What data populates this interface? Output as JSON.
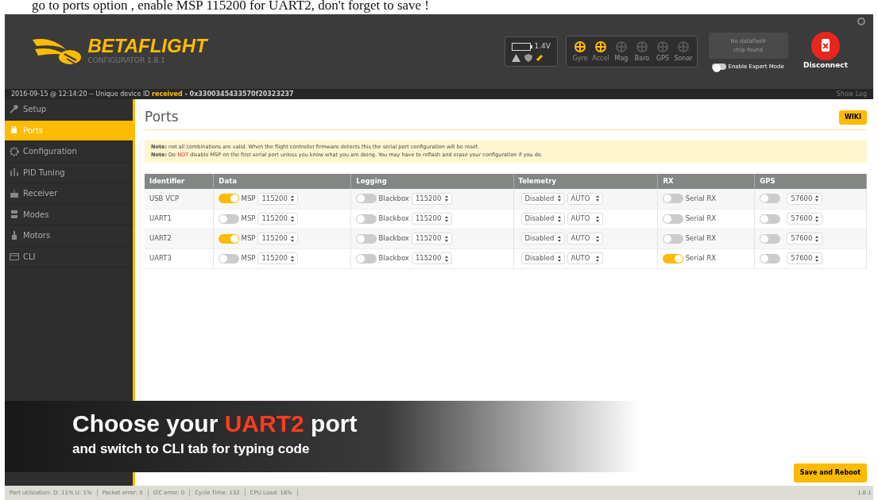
{
  "video_caption": "go to ports option , enable MSP 115200 for UART2, don't forget to save !",
  "header": {
    "logo_title": "BETAFLIGHT",
    "logo_subtitle": "CONFIGURATOR 1.8.1",
    "battery": "1.4V",
    "sensors": [
      {
        "label": "Gyro",
        "active": true
      },
      {
        "label": "Accel",
        "active": true
      },
      {
        "label": "Mag",
        "active": false
      },
      {
        "label": "Baro",
        "active": false
      },
      {
        "label": "GPS",
        "active": false
      },
      {
        "label": "Sonar",
        "active": false
      }
    ],
    "dataflash": "No dataflash chip found",
    "expert_mode": {
      "label": "Enable Expert Mode",
      "on": false
    },
    "disconnect": "Disconnect"
  },
  "log": {
    "parts": [
      {
        "text": "2016-09-15 @ 12:14:20 -- Unique device ID ",
        "kind": "plain"
      },
      {
        "text": "received",
        "kind": "highlight"
      },
      {
        "text": " - 0x3300345433570f20323237",
        "kind": "bold"
      }
    ],
    "show_log": "Show Log"
  },
  "sidebar": {
    "items": [
      {
        "label": "Setup",
        "selected": false
      },
      {
        "label": "Ports",
        "selected": true
      },
      {
        "label": "Configuration",
        "selected": false
      },
      {
        "label": "PID Tuning",
        "selected": false
      },
      {
        "label": "Receiver",
        "selected": false
      },
      {
        "label": "Modes",
        "selected": false
      },
      {
        "label": "Motors",
        "selected": false
      },
      {
        "label": "CLI",
        "selected": false
      }
    ]
  },
  "page": {
    "title": "Ports",
    "wiki": "WIKI",
    "notes": [
      [
        {
          "text": "Note:",
          "kind": "bold"
        },
        {
          "text": " not all combinations are valid. When the flight controller firmware detects this the serial port configuration will be reset.",
          "kind": "plain"
        }
      ],
      [
        {
          "text": "Note:",
          "kind": "bold"
        },
        {
          "text": " Do ",
          "kind": "plain"
        },
        {
          "text": "NOT",
          "kind": "warn"
        },
        {
          "text": " disable MSP on the first serial port unless you know what you are doing. You may have to reflash and erase your configuration if you do.",
          "kind": "plain"
        }
      ]
    ],
    "table": {
      "columns": [
        "Identifier",
        "Data",
        "Logging",
        "Telemetry",
        "RX",
        "GPS"
      ],
      "rows": [
        {
          "identifier": "USB VCP",
          "data": {
            "on": true,
            "label": "MSP",
            "baud": "115200"
          },
          "logging": {
            "on": false,
            "label": "Blackbox",
            "baud": "115200"
          },
          "telemetry": {
            "protocol": "Disabled",
            "baud": "AUTO"
          },
          "rx": {
            "on": false,
            "label": "Serial RX"
          },
          "gps": {
            "on": false,
            "baud": "57600"
          }
        },
        {
          "identifier": "UART1",
          "data": {
            "on": false,
            "label": "MSP",
            "baud": "115200"
          },
          "logging": {
            "on": false,
            "label": "Blackbox",
            "baud": "115200"
          },
          "telemetry": {
            "protocol": "Disabled",
            "baud": "AUTO"
          },
          "rx": {
            "on": false,
            "label": "Serial RX"
          },
          "gps": {
            "on": false,
            "baud": "57600"
          }
        },
        {
          "identifier": "UART2",
          "data": {
            "on": true,
            "label": "MSP",
            "baud": "115200"
          },
          "logging": {
            "on": false,
            "label": "Blackbox",
            "baud": "115200"
          },
          "telemetry": {
            "protocol": "Disabled",
            "baud": "AUTO"
          },
          "rx": {
            "on": false,
            "label": "Serial RX"
          },
          "gps": {
            "on": false,
            "baud": "57600"
          }
        },
        {
          "identifier": "UART3",
          "data": {
            "on": false,
            "label": "MSP",
            "baud": "115200"
          },
          "logging": {
            "on": false,
            "label": "Blackbox",
            "baud": "115200"
          },
          "telemetry": {
            "protocol": "Disabled",
            "baud": "AUTO"
          },
          "rx": {
            "on": true,
            "label": "Serial RX"
          },
          "gps": {
            "on": false,
            "baud": "57600"
          }
        }
      ]
    },
    "save": "Save and Reboot"
  },
  "overlay": {
    "title_parts": [
      {
        "text": "Choose your ",
        "kind": "plain"
      },
      {
        "text": "UART2",
        "kind": "highlight"
      },
      {
        "text": " port",
        "kind": "plain"
      }
    ],
    "subtitle": "and switch to CLI tab for typing code"
  },
  "status_bar": {
    "items": [
      "Port utilization: D: 11% U: 1%",
      "Packet error: 0",
      "I2C error: 0",
      "Cycle Time: 132",
      "CPU Load: 16%"
    ],
    "version": "1.8.1"
  }
}
